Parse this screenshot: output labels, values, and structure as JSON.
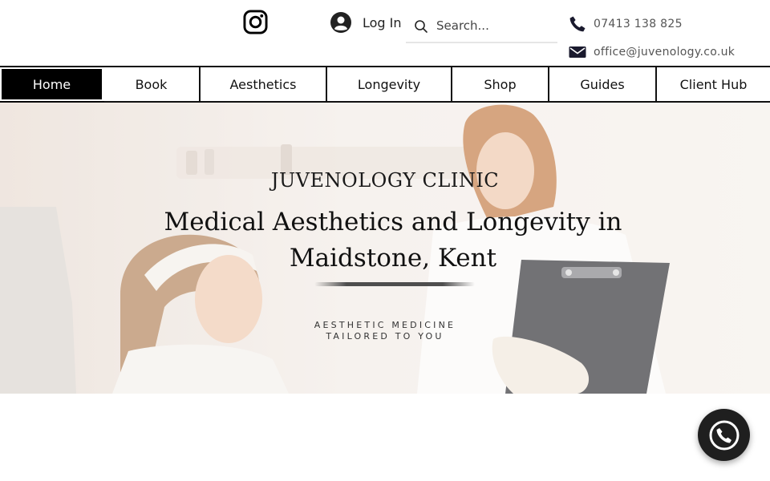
{
  "header": {
    "instagram_icon": "instagram-icon",
    "login_label": "Log In",
    "search_placeholder": "Search...",
    "phone": "07413 138 825",
    "email": "office@juvenology.co.uk"
  },
  "nav": {
    "items": [
      {
        "label": "Home",
        "active": true
      },
      {
        "label": "Book"
      },
      {
        "label": "Aesthetics"
      },
      {
        "label": "Longevity"
      },
      {
        "label": "Shop"
      },
      {
        "label": "Guides"
      },
      {
        "label": "Client Hub"
      }
    ]
  },
  "hero": {
    "eyebrow": "JUVENOLOGY CLINIC",
    "headline_line1": "Medical Aesthetics and Longevity in",
    "headline_line2": "Maidstone, Kent",
    "tagline_line1": "AESTHETIC MEDICINE",
    "tagline_line2": "TAILORED TO YOU"
  },
  "chat": {
    "icon": "whatsapp-phone-icon"
  },
  "colors": {
    "accent": "#000000",
    "nav_active_text": "#ffffff",
    "chat_bg": "#1f1f1f"
  }
}
